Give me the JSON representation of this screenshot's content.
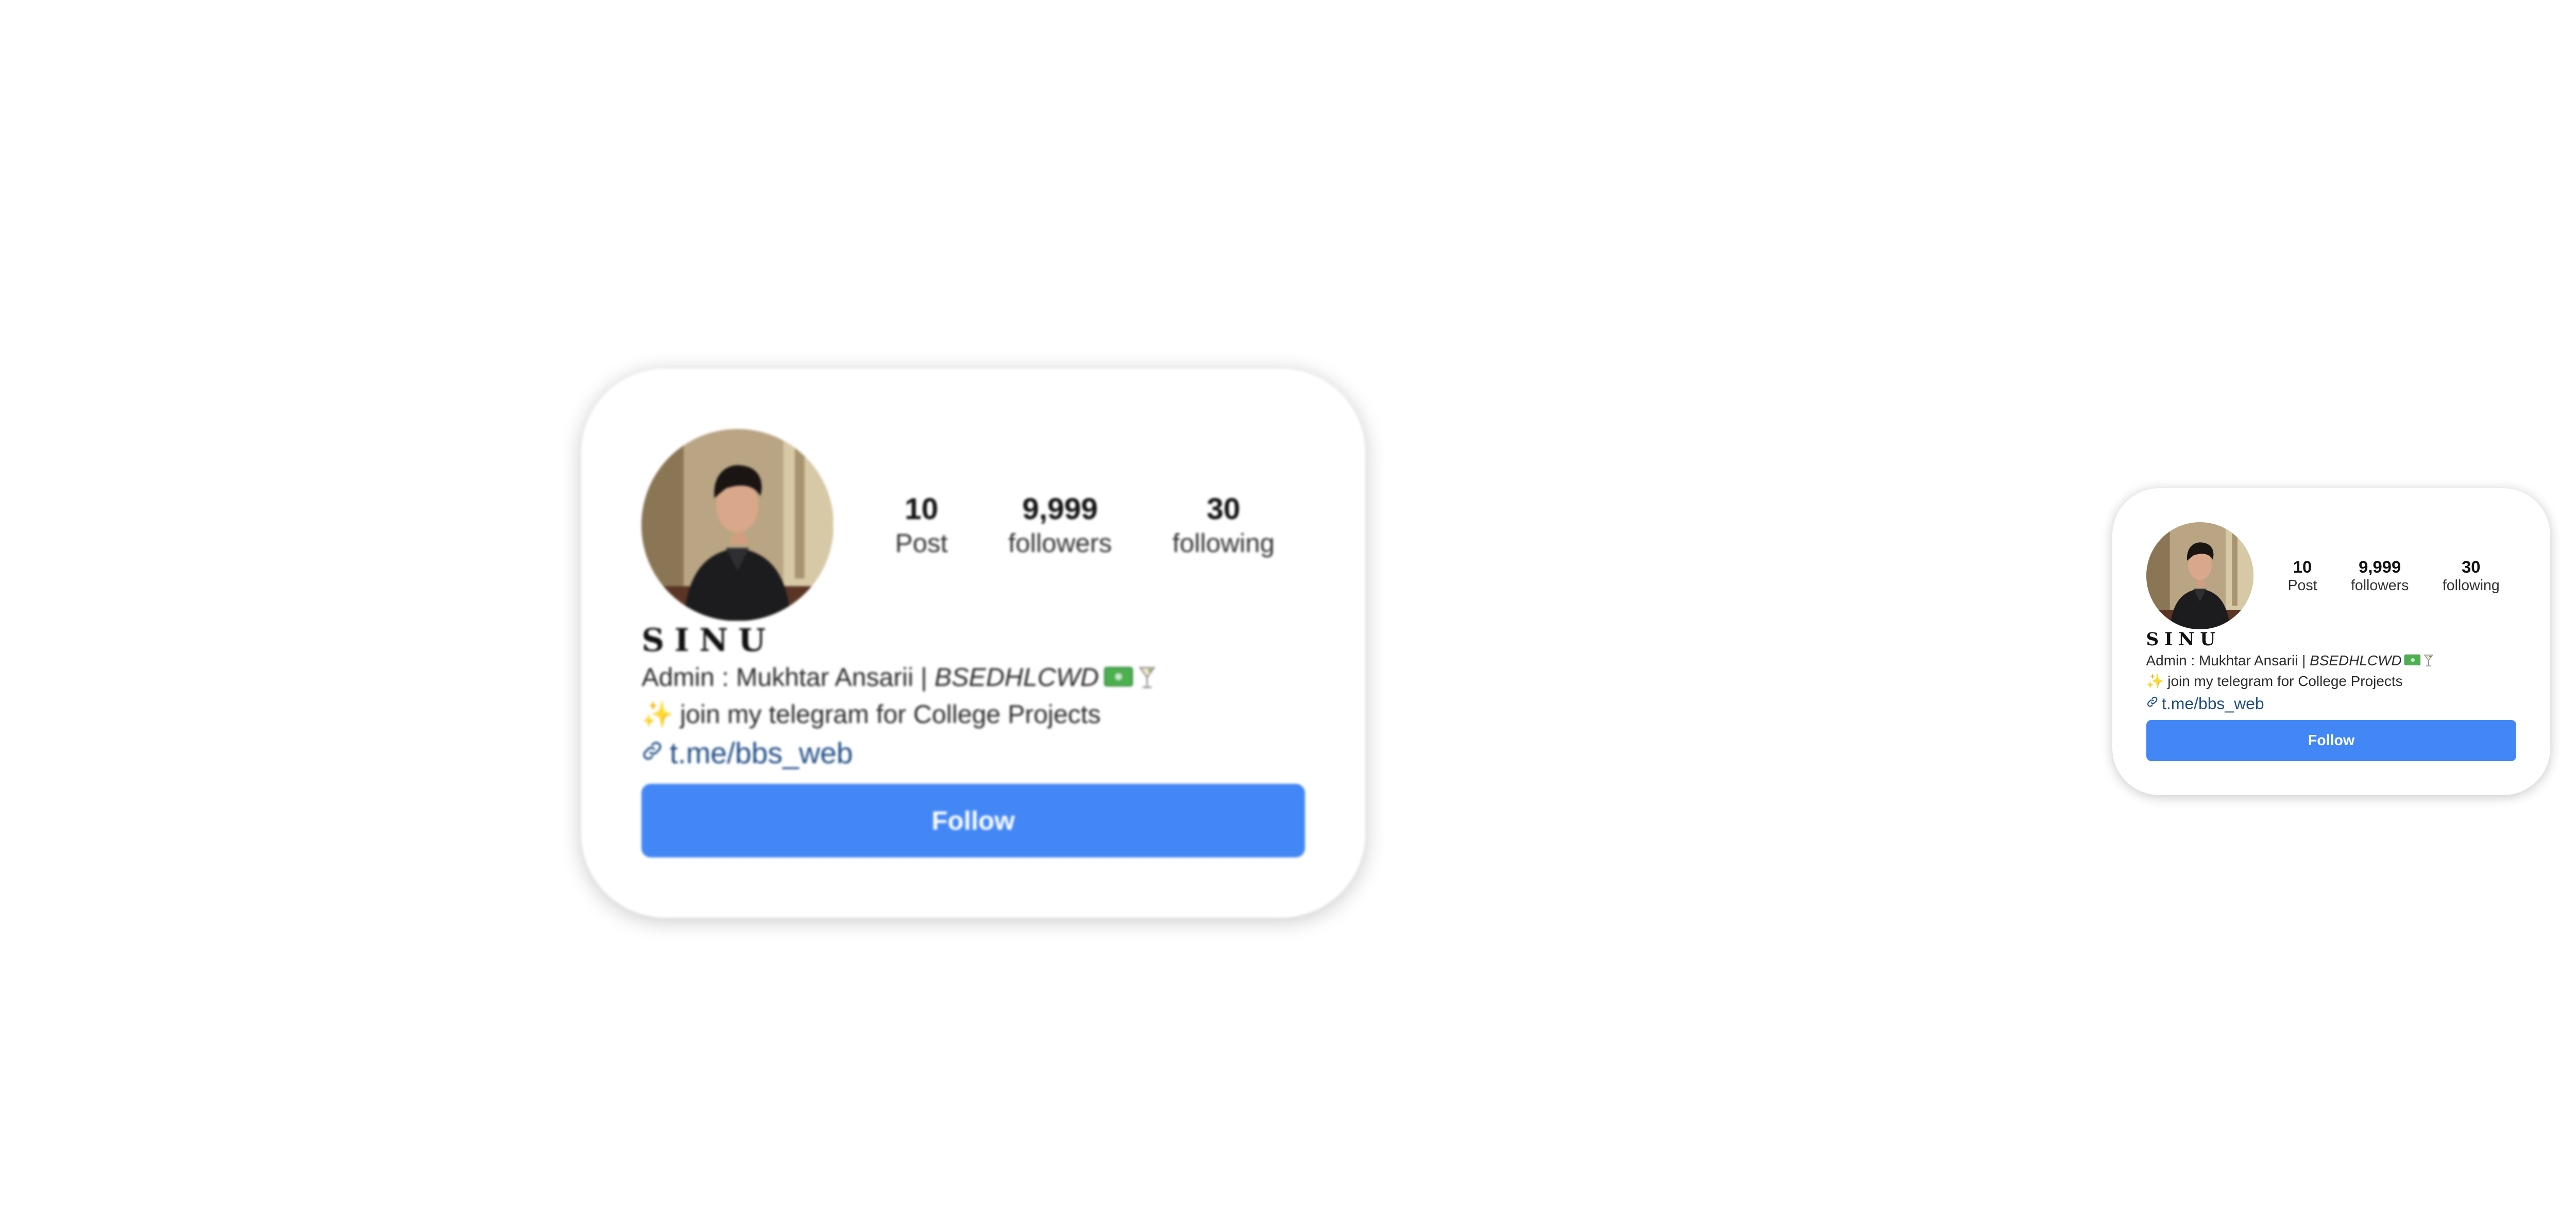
{
  "profile_cards": [
    {
      "variant": "large",
      "stats": [
        {
          "count": "10",
          "label": "Post"
        },
        {
          "count": "9,999",
          "label": "followers"
        },
        {
          "count": "30",
          "label": "following"
        }
      ],
      "name": "SINU",
      "bio": {
        "line1_prefix": "Admin : Mukhtar Ansarii | ",
        "line1_italic": "BSEDHLCWD",
        "line2": "join my telegram for College Projects"
      },
      "link": "t.me/bbs_web",
      "follow_label": "Follow"
    },
    {
      "variant": "small",
      "stats": [
        {
          "count": "10",
          "label": "Post"
        },
        {
          "count": "9,999",
          "label": "followers"
        },
        {
          "count": "30",
          "label": "following"
        }
      ],
      "name": "SINU",
      "bio": {
        "line1_prefix": "Admin : Mukhtar Ansarii | ",
        "line1_italic": "BSEDHLCWD",
        "line2": "join my telegram for College Projects"
      },
      "link": "t.me/bbs_web",
      "follow_label": "Follow"
    }
  ],
  "icons": {
    "avatar": "profile-photo",
    "bio_emoji_1": "money-icon",
    "bio_emoji_2": "cocktail-icon",
    "bio_emoji_3": "sparkles-icon",
    "link": "link-icon"
  },
  "colors": {
    "follow_button": "#4287f5",
    "link_text": "#1f4e86",
    "card_background": "#ffffff"
  }
}
